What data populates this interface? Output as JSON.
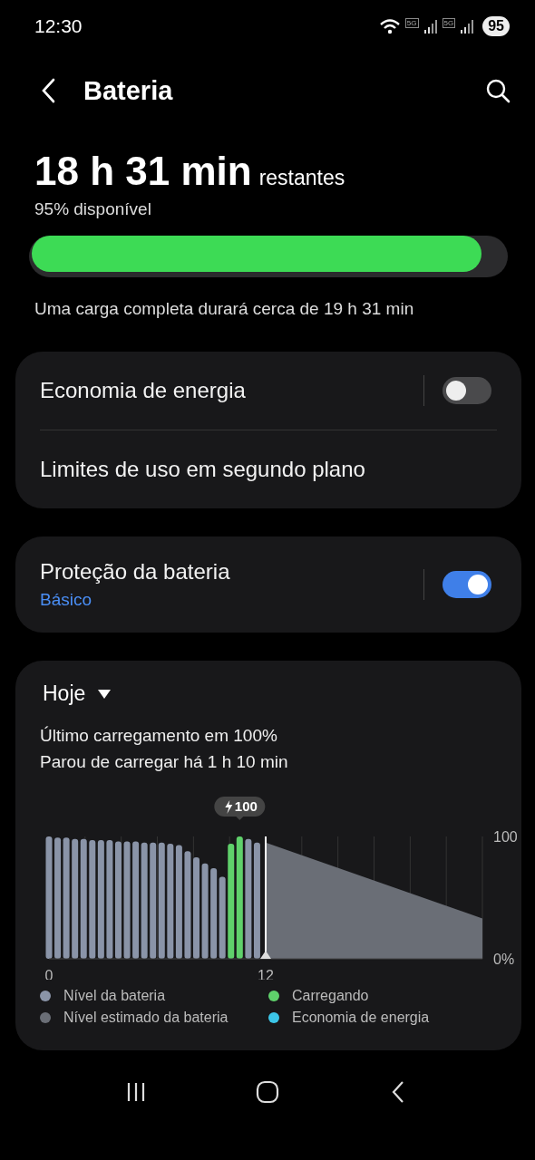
{
  "status_bar": {
    "time": "12:30",
    "network_labels": [
      "5G",
      "5G"
    ],
    "battery": "95"
  },
  "header": {
    "title": "Bateria"
  },
  "summary": {
    "time_left": "18 h 31 min",
    "suffix": "restantes",
    "available": "95% disponível",
    "level": 0.95,
    "full_charge": "Uma carga completa durará cerca de 19 h 31 min"
  },
  "settings_groups": [
    {
      "items": [
        {
          "kind": "toggle",
          "label": "Economia de energia",
          "on": false
        },
        {
          "kind": "link",
          "label": "Limites de uso em segundo plano"
        }
      ]
    },
    {
      "items": [
        {
          "kind": "toggle",
          "label": "Proteção da bateria",
          "subtitle": "Básico",
          "on": true
        }
      ]
    }
  ],
  "usage": {
    "period": "Hoje",
    "lines": [
      "Último carregamento em 100%",
      "Parou de carregar há 1 h 10 min"
    ],
    "chart_data": {
      "type": "bar",
      "x": [
        0,
        0.48,
        0.96,
        1.44,
        1.92,
        2.4,
        2.88,
        3.36,
        3.84,
        4.32,
        4.8,
        5.28,
        5.76,
        6.24,
        6.72,
        7.2,
        7.68,
        8.16,
        8.64,
        9.12,
        9.6,
        10.08,
        10.56,
        11.04,
        11.52,
        12,
        24
      ],
      "xlim": [
        0,
        24
      ],
      "ylim": [
        0,
        100
      ],
      "xticks": [
        0,
        12
      ],
      "yticks": [
        {
          "value": 0,
          "label": "0%"
        },
        {
          "value": 100,
          "label": "100"
        }
      ],
      "series": [
        {
          "name": "Nível da bateria",
          "color": "#8a94a8",
          "values": [
            100,
            99,
            99,
            98,
            98,
            97,
            97,
            97,
            96,
            96,
            96,
            95,
            95,
            95,
            94,
            93,
            88,
            83,
            78,
            74,
            67,
            null,
            null,
            98,
            95,
            null,
            null
          ]
        },
        {
          "name": "Carregando",
          "color": "#5fd16b",
          "values": [
            null,
            null,
            null,
            null,
            null,
            null,
            null,
            null,
            null,
            null,
            null,
            null,
            null,
            null,
            null,
            null,
            null,
            null,
            null,
            null,
            null,
            94,
            100,
            null,
            null,
            null,
            null
          ]
        },
        {
          "name": "Nível estimado da bateria",
          "type": "area",
          "color": "#6a6e76",
          "values": [
            null,
            null,
            null,
            null,
            null,
            null,
            null,
            null,
            null,
            null,
            null,
            null,
            null,
            null,
            null,
            null,
            null,
            null,
            null,
            null,
            null,
            null,
            null,
            null,
            null,
            95,
            33
          ]
        }
      ],
      "annotations": [
        {
          "x": 10.56,
          "y": 100,
          "text": "100"
        }
      ],
      "ref_lines": [
        {
          "axis": "x",
          "value": 12
        }
      ]
    },
    "legend": [
      {
        "label": "Economia de energia",
        "color": "#3cc6e8"
      }
    ]
  }
}
